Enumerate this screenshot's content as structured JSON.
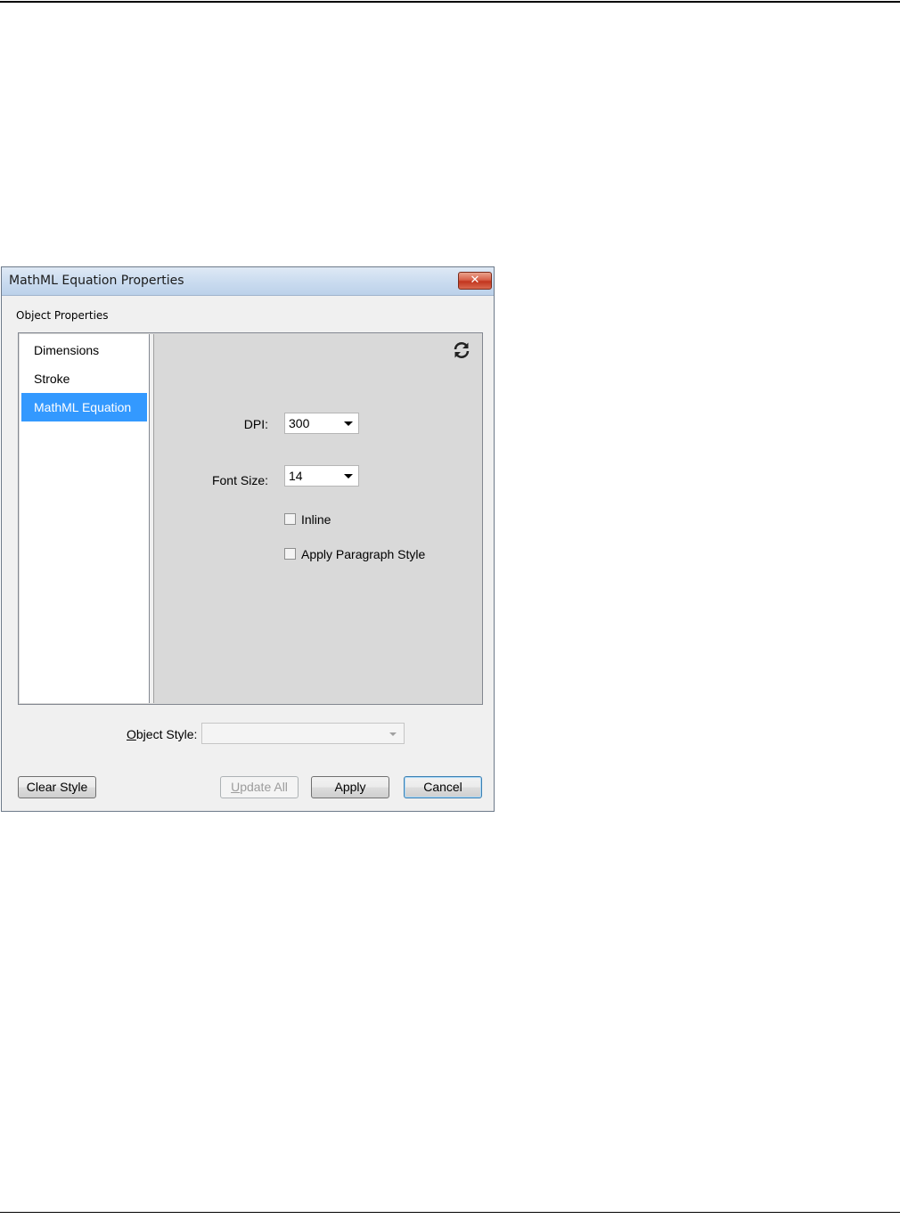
{
  "window": {
    "title": "MathML Equation Properties",
    "close_glyph": "✕"
  },
  "group_label": "Object Properties",
  "nav": {
    "items": [
      {
        "label": "Dimensions",
        "selected": false
      },
      {
        "label": "Stroke",
        "selected": false
      },
      {
        "label": "MathML Equation",
        "selected": true
      }
    ]
  },
  "content": {
    "refresh_icon": "refresh-icon",
    "dpi": {
      "label": "DPI:",
      "value": "300"
    },
    "font_size": {
      "label": "Font Size:",
      "value": "14"
    },
    "inline": {
      "label": "Inline",
      "checked": false
    },
    "apply_paragraph_style": {
      "label": "Apply Paragraph Style",
      "checked": false
    }
  },
  "object_style": {
    "label_prefix": "O",
    "label_rest": "bject Style:",
    "value": ""
  },
  "buttons": {
    "clear_style": "Clear Style",
    "update_all_prefix": "U",
    "update_all_rest": "pdate All",
    "apply": "Apply",
    "cancel": "Cancel"
  },
  "colors": {
    "selection": "#3399ff",
    "dialog_bg": "#f0f0f0",
    "panel_bg": "#d9d9d9"
  }
}
